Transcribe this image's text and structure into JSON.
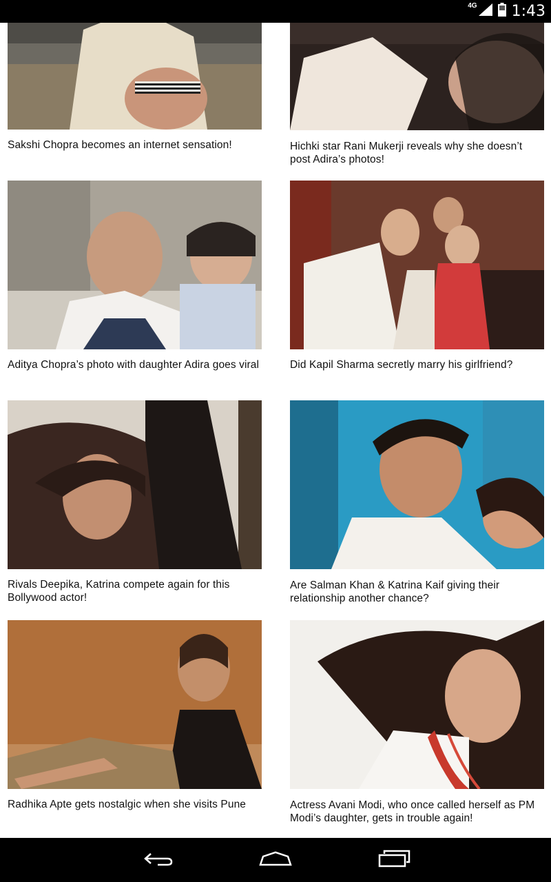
{
  "status_bar": {
    "network": "4G",
    "time": "1:43",
    "icons": [
      "signal-icon",
      "battery-icon"
    ]
  },
  "articles": [
    {
      "title": "Sakshi Chopra becomes an internet sensation!"
    },
    {
      "title": "Hichki star Rani Mukerji reveals why she doesn’t post Adira’s photos!"
    },
    {
      "title": "Aditya Chopra’s photo with daughter Adira goes viral"
    },
    {
      "title": "Did Kapil Sharma secretly marry his girlfriend?"
    },
    {
      "title": "Rivals Deepika, Katrina compete again for this Bollywood actor!"
    },
    {
      "title": "Are Salman Khan & Katrina Kaif giving their relationship another chance?"
    },
    {
      "title": "Radhika Apte gets nostalgic when she visits Pune"
    },
    {
      "title": "Actress Avani Modi, who once called herself as PM Modi’s daughter, gets in trouble again!"
    }
  ],
  "nav_bar": {
    "buttons": [
      "back-icon",
      "home-icon",
      "recent-apps-icon"
    ]
  }
}
